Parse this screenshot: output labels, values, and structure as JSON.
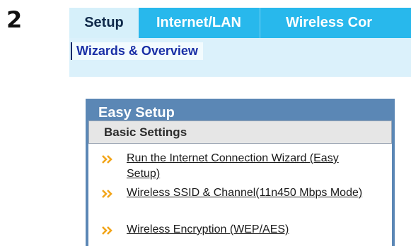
{
  "step_number": "2",
  "tabs": [
    {
      "label": "Setup"
    },
    {
      "label": "Internet/LAN"
    },
    {
      "label": "Wireless Cor"
    }
  ],
  "subtab": {
    "label": "Wizards & Overview"
  },
  "panel": {
    "title": "Easy Setup",
    "section": "Basic Settings",
    "links": [
      {
        "label": "Run the Internet Connection Wizard (Easy Setup)"
      },
      {
        "label": "Wireless SSID & Channel(11n450 Mbps Mode)"
      },
      {
        "label": "Wireless Encryption (WEP/AES)"
      }
    ]
  },
  "colors": {
    "tab_bar": "#28b8ec",
    "active_tab": "#d6f0fa",
    "subbar": "#dbf1fb",
    "panel": "#5b87b5",
    "bullet": "#f2a51a"
  },
  "icons": {
    "link_bullet": "double-chevron-right-icon"
  }
}
